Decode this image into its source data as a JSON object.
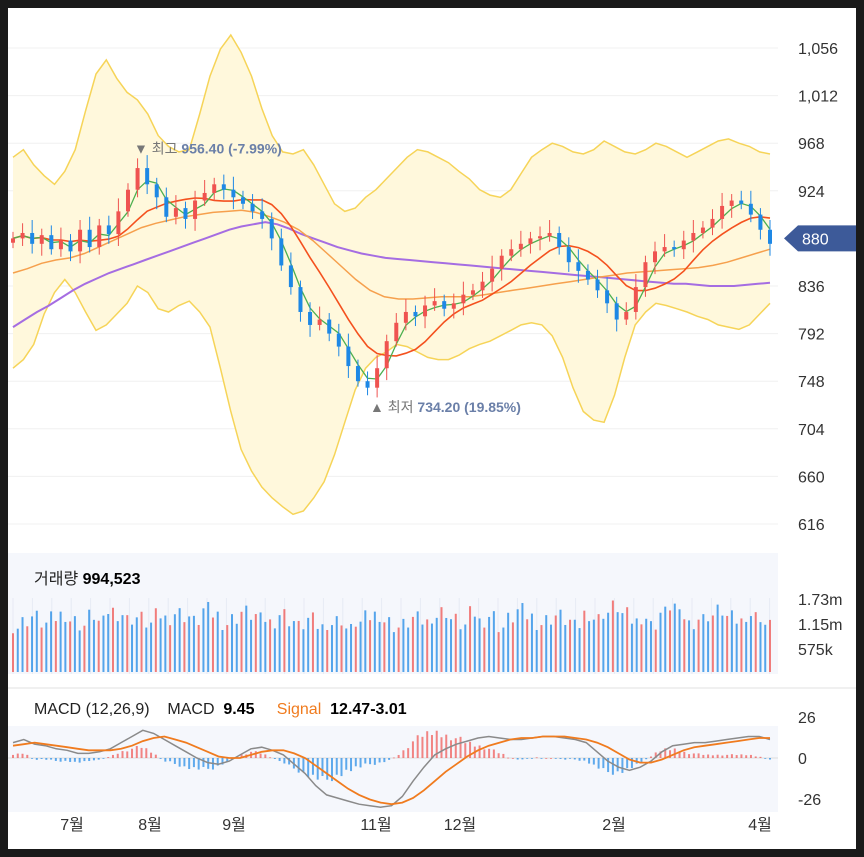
{
  "chart_data": {
    "type": "candlestick",
    "price_axis": {
      "ticks": [
        "1,056",
        "1,012",
        "968",
        "924",
        "880",
        "836",
        "792",
        "748",
        "704",
        "660",
        "616"
      ],
      "range": [
        616,
        1056
      ],
      "current": "880"
    },
    "x_axis": {
      "ticks": [
        "7월",
        "8월",
        "9월",
        "11월",
        "12월",
        "2월",
        "4월"
      ]
    },
    "annotations": {
      "high": {
        "marker": "▼",
        "label": "최고",
        "value": "956.40",
        "pct": "(-7.99%)"
      },
      "low": {
        "marker": "▲",
        "label": "최저",
        "value": "734.20",
        "pct": "(19.85%)"
      }
    },
    "close_series": [
      880,
      885,
      875,
      883,
      870,
      878,
      868,
      888,
      872,
      892,
      884,
      905,
      925,
      945,
      930,
      918,
      900,
      908,
      898,
      915,
      922,
      930,
      925,
      918,
      912,
      905,
      898,
      880,
      855,
      835,
      812,
      800,
      805,
      792,
      780,
      762,
      748,
      742,
      760,
      785,
      802,
      812,
      808,
      818,
      822,
      815,
      820,
      828,
      832,
      840,
      852,
      864,
      870,
      875,
      880,
      882,
      885,
      872,
      858,
      850,
      842,
      832,
      820,
      805,
      812,
      835,
      858,
      868,
      872,
      870,
      878,
      885,
      890,
      898,
      910,
      915,
      912,
      902,
      888,
      875
    ],
    "upper_band": [
      955,
      962,
      948,
      938,
      930,
      942,
      962,
      998,
      1032,
      1045,
      1028,
      1015,
      1008,
      995,
      975,
      965,
      960,
      962,
      995,
      1030,
      1055,
      1068,
      1052,
      1030,
      1000,
      975,
      960,
      958,
      962,
      948,
      930,
      912,
      905,
      908,
      918,
      925,
      935,
      945,
      955,
      962,
      960,
      955,
      950,
      942,
      935,
      925,
      920,
      918,
      925,
      940,
      955,
      962,
      968,
      965,
      960,
      958,
      962,
      970,
      965,
      960,
      958,
      962,
      968,
      965,
      960,
      955,
      960,
      965,
      970,
      972,
      968,
      965,
      960,
      958
    ],
    "lower_band": [
      760,
      768,
      782,
      810,
      830,
      842,
      830,
      812,
      795,
      800,
      810,
      820,
      836,
      830,
      815,
      812,
      818,
      822,
      812,
      798,
      760,
      720,
      685,
      665,
      650,
      640,
      632,
      625,
      628,
      640,
      655,
      680,
      710,
      740,
      760,
      770,
      775,
      782,
      780,
      775,
      770,
      768,
      768,
      772,
      778,
      782,
      785,
      790,
      795,
      800,
      802,
      800,
      790,
      770,
      742,
      720,
      712,
      710,
      735,
      770,
      800,
      812,
      820,
      818,
      815,
      812,
      808,
      805,
      800,
      798,
      796,
      800,
      810,
      820
    ],
    "ma_long": [
      798,
      805,
      812,
      818,
      825,
      832,
      838,
      843,
      848,
      852,
      856,
      860,
      864,
      868,
      872,
      876,
      880,
      884,
      888,
      891,
      893,
      895,
      893,
      889,
      884,
      880,
      876,
      872,
      869,
      866,
      864,
      862,
      861,
      860,
      859,
      858,
      857,
      856,
      855,
      854,
      853,
      852,
      851,
      850,
      849,
      848,
      847,
      846,
      845,
      844,
      843,
      842,
      841,
      840,
      839,
      838,
      838,
      837,
      836,
      836,
      836,
      837,
      838,
      839
    ],
    "ma_mid": [
      848,
      852,
      857,
      860,
      862,
      866,
      872,
      878,
      884,
      890,
      894,
      897,
      900,
      902,
      904,
      905,
      906,
      904,
      900,
      895,
      888,
      878,
      866,
      854,
      842,
      832,
      826,
      824,
      824,
      825,
      826,
      826,
      826,
      828,
      830,
      832,
      834,
      836,
      838,
      840,
      842,
      844,
      846,
      848,
      849,
      850,
      851,
      852,
      853,
      855,
      858,
      862,
      866,
      870
    ],
    "volume": [
      48,
      55,
      60,
      52,
      58,
      62,
      56,
      50,
      61,
      54,
      66,
      63,
      57,
      59,
      52,
      61,
      58,
      64,
      60,
      55,
      67,
      62,
      52,
      58,
      65,
      61,
      57,
      54,
      63,
      55,
      50,
      57,
      49,
      52,
      56,
      47,
      53,
      59,
      62,
      55,
      48,
      52,
      58,
      54,
      60,
      65,
      57,
      50,
      63,
      55,
      61,
      48,
      58,
      66,
      60,
      52,
      57,
      61,
      55,
      50,
      63,
      58,
      64,
      70,
      62,
      55,
      59,
      51,
      64,
      72,
      60,
      53,
      58,
      61,
      66,
      59,
      55,
      62,
      60,
      51
    ],
    "vol_axis": {
      "ticks": [
        "1.73m",
        "1.15m",
        "575k"
      ]
    },
    "vol_header": {
      "label": "거래량",
      "value": "994,523"
    },
    "macd_header": {
      "label": "MACD",
      "params": "(12,26,9)",
      "macd_label": "MACD",
      "macd_value": "9.45",
      "signal_label": "Signal",
      "signal_value": "12.47",
      "hist_value": "-3.01"
    },
    "macd_axis": {
      "ticks": [
        "26",
        "0",
        "-26"
      ]
    },
    "macd_line": [
      10,
      12,
      9,
      8,
      6,
      5,
      3,
      3,
      4,
      6,
      10,
      14,
      18,
      16,
      12,
      8,
      4,
      0,
      -3,
      -4,
      -2,
      2,
      6,
      7,
      5,
      2,
      -4,
      -10,
      -18,
      -24,
      -26,
      -28,
      -30,
      -31,
      -32,
      -31,
      -25,
      -15,
      -6,
      2,
      6,
      9,
      11,
      13,
      14,
      13,
      12,
      12,
      13,
      14,
      14,
      13,
      12,
      10,
      4,
      -2,
      -6,
      -8,
      -6,
      -2,
      4,
      8,
      9,
      10,
      10,
      11,
      12,
      13,
      14,
      14,
      12
    ],
    "signal_line": [
      8,
      9,
      10,
      9,
      8,
      7,
      6,
      5,
      5,
      5,
      6,
      8,
      11,
      13,
      14,
      12,
      10,
      7,
      4,
      1,
      0,
      0,
      2,
      4,
      5,
      5,
      3,
      0,
      -5,
      -10,
      -15,
      -20,
      -24,
      -27,
      -29,
      -30,
      -29,
      -26,
      -21,
      -15,
      -9,
      -4,
      1,
      5,
      8,
      10,
      12,
      13,
      13,
      14,
      14,
      14,
      13,
      12,
      10,
      7,
      3,
      -1,
      -3,
      -3,
      -1,
      2,
      5,
      7,
      8,
      9,
      10,
      11,
      12,
      13,
      13
    ]
  },
  "colors": {
    "up": "#ef5350",
    "down": "#1e88e5",
    "ma_short": "#4caf50",
    "ma_20": "#f4511e",
    "ma_mid": "#f6a04d",
    "ma_long": "#a56de2",
    "band_fill": "#fff8dc",
    "band_line": "#f6d458",
    "macd": "#8a8a8a",
    "signal": "#f07b1e",
    "price_tag": "#3d5a99",
    "ann_text": "#6a7fa8"
  }
}
